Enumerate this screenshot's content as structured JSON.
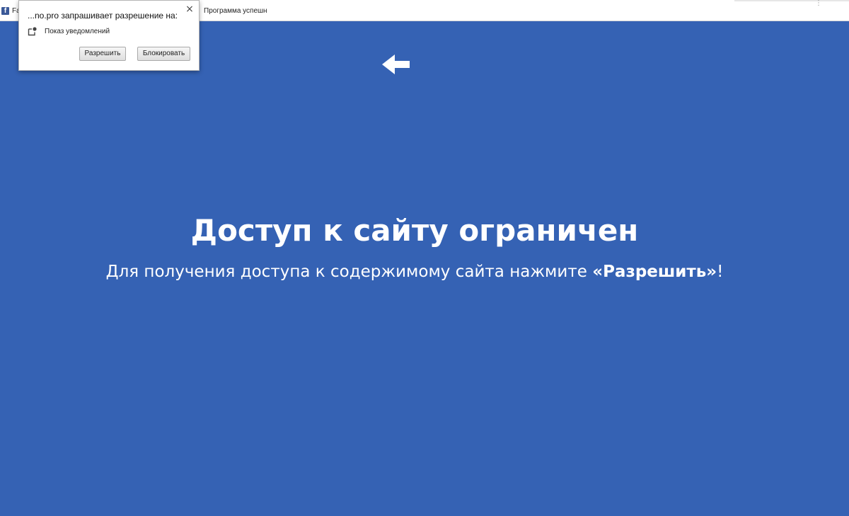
{
  "bookmarks_bar": {
    "items": [
      {
        "icon": "facebook-icon",
        "label": "Fa"
      },
      {
        "icon": "",
        "label": "Программа успешн"
      }
    ],
    "menu_dots": "⋮"
  },
  "permission_popup": {
    "title": "...no.pro запрашивает разрешение на:",
    "permission_icon": "notification-icon",
    "permission_label": "Показ уведомлений",
    "allow_label": "Разрешить",
    "block_label": "Блокировать",
    "close_glyph": "×"
  },
  "page": {
    "background_color": "#3562b4",
    "arrow_icon": "left-arrow-icon",
    "headline": "Доступ к сайту ограничен",
    "subline_prefix": "Для получения доступа к содержимому сайта нажмите ",
    "subline_emphasis": "«Разрешить»",
    "subline_suffix": "!"
  }
}
